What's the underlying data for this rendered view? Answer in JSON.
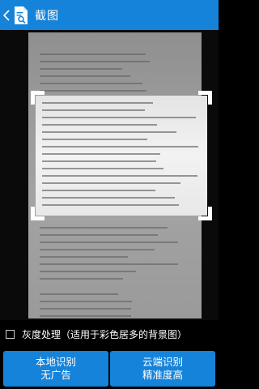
{
  "header": {
    "title": "截图",
    "back_icon": "chevron-left-icon",
    "app_icon": "document-search-icon",
    "background": "#1583d9"
  },
  "option": {
    "label": "灰度处理（适用于彩色居多的背景图）",
    "checked": false
  },
  "buttons": {
    "local": {
      "line1": "本地识别",
      "line2": "无广告"
    },
    "cloud": {
      "line1": "云端识别",
      "line2": "精准度高"
    }
  }
}
